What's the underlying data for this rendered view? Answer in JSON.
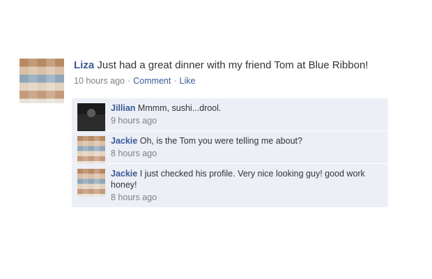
{
  "post": {
    "author": "Liza",
    "text": "Just had a great dinner with my friend Tom at Blue Ribbon!",
    "time": "10 hours ago",
    "comment_label": "Comment",
    "like_label": "Like",
    "separator": "·"
  },
  "comments": [
    {
      "author": "Jillian",
      "text": "Mmmm, sushi...drool.",
      "time": "9 hours ago"
    },
    {
      "author": "Jackie",
      "text": "Oh, is the Tom you were telling me about?",
      "time": "8 hours ago"
    },
    {
      "author": "Jackie",
      "text": "I just checked his profile. Very nice looking guy! good work honey!",
      "time": "8 hours ago"
    }
  ]
}
